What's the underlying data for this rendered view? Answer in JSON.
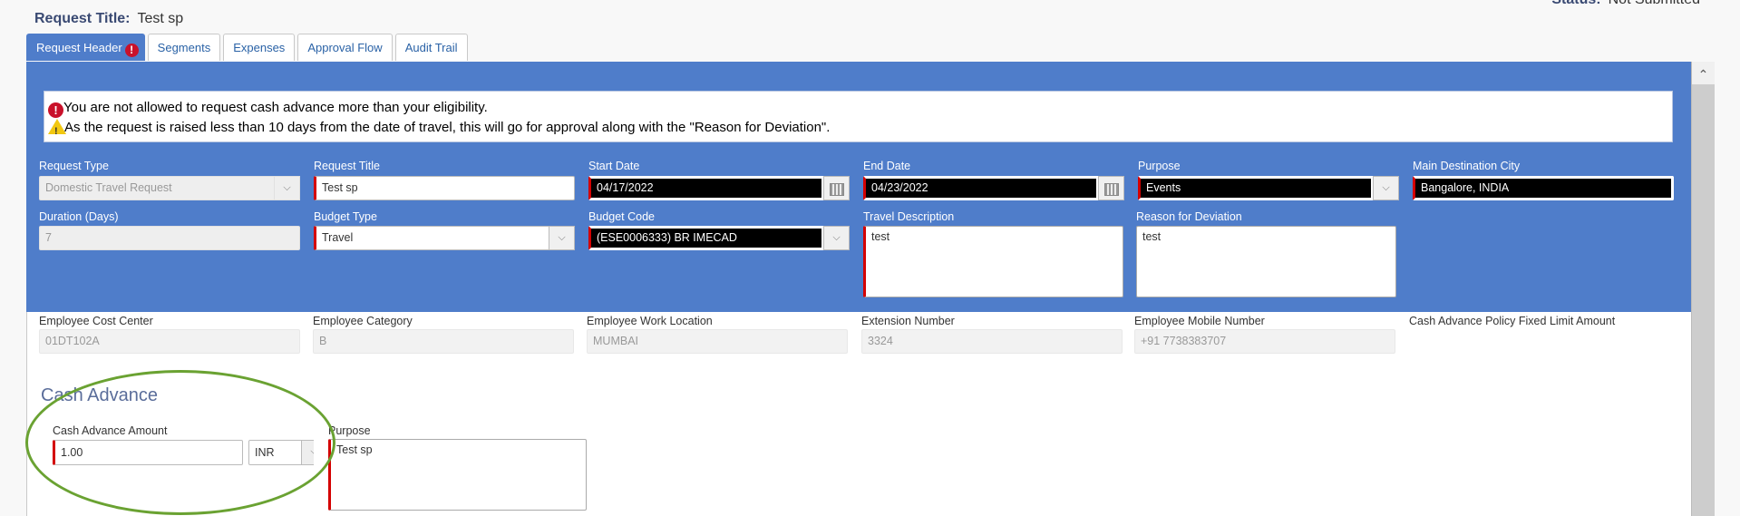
{
  "header": {
    "title_label": "Request Title:",
    "title_value": "Test sp",
    "status_label": "Status:",
    "status_value": "Not Submitted"
  },
  "tabs": [
    {
      "label": "Request Header",
      "active": true,
      "has_error": true,
      "error_glyph": "!"
    },
    {
      "label": "Segments"
    },
    {
      "label": "Expenses"
    },
    {
      "label": "Approval Flow"
    },
    {
      "label": "Audit Trail"
    }
  ],
  "alerts": [
    {
      "type": "error",
      "icon": "error-icon",
      "glyph": "!",
      "text": "You are not allowed to request cash advance more than your eligibility."
    },
    {
      "type": "warning",
      "icon": "warning-icon",
      "glyph": "!",
      "text": "As the request is raised less than 10 days from the date of travel, this will go for approval along with the \"Reason for Deviation\"."
    }
  ],
  "form": {
    "request_type": {
      "label": "Request Type",
      "value": "Domestic Travel Request"
    },
    "request_title": {
      "label": "Request Title",
      "value": "Test sp"
    },
    "start_date": {
      "label": "Start Date",
      "value": "04/17/2022"
    },
    "end_date": {
      "label": "End Date",
      "value": "04/23/2022"
    },
    "purpose": {
      "label": "Purpose",
      "value": "Events"
    },
    "main_destination_city": {
      "label": "Main Destination City",
      "value": "Bangalore, INDIA"
    },
    "duration": {
      "label": "Duration (Days)",
      "value": "7"
    },
    "budget_type": {
      "label": "Budget Type",
      "value": "Travel"
    },
    "budget_code": {
      "label": "Budget Code",
      "value": "(ESE0006333) BR IMECAD"
    },
    "travel_description": {
      "label": "Travel Description",
      "value": "test"
    },
    "reason_for_deviation": {
      "label": "Reason for Deviation",
      "value": "test"
    }
  },
  "employee": {
    "cost_center": {
      "label": "Employee Cost Center",
      "value": "01DT102A"
    },
    "category": {
      "label": "Employee Category",
      "value": "B"
    },
    "work_location": {
      "label": "Employee Work Location",
      "value": "MUMBAI"
    },
    "extension": {
      "label": "Extension Number",
      "value": "3324"
    },
    "mobile": {
      "label": "Employee Mobile Number",
      "value": "+91 7738383707"
    },
    "policy_limit": {
      "label": "Cash Advance Policy Fixed Limit Amount"
    }
  },
  "cash_advance": {
    "heading": "Cash Advance",
    "amount_label": "Cash Advance Amount",
    "amount_value": "1.00",
    "currency": "INR",
    "purpose_label": "Purpose",
    "purpose_value": "Test sp"
  },
  "icons": {
    "dropdown": "⌵",
    "scroll_up": "⌃"
  }
}
